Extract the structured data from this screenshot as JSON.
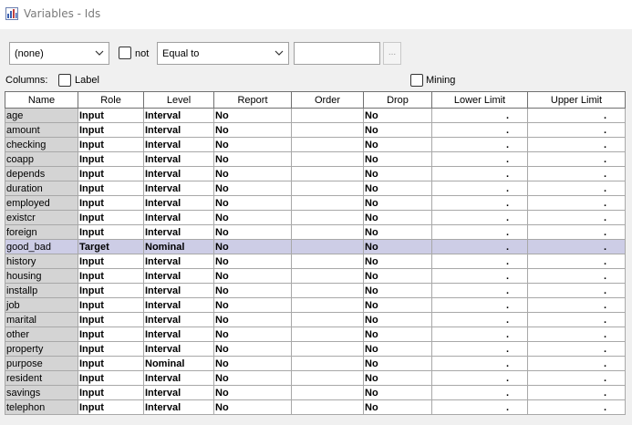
{
  "window": {
    "title": "Variables - Ids"
  },
  "filter": {
    "column_select": "(none)",
    "not_label": "not",
    "operator_select": "Equal to",
    "value_input": "",
    "ellipsis_label": "..."
  },
  "columns_row": {
    "columns_label": "Columns:",
    "label_checkbox": "Label",
    "mining_checkbox": "Mining"
  },
  "table": {
    "headers": [
      "Name",
      "Role",
      "Level",
      "Report",
      "Order",
      "Drop",
      "Lower Limit",
      "Upper Limit"
    ],
    "rows": [
      {
        "name": "age",
        "role": "Input",
        "level": "Interval",
        "report": "No",
        "order": "",
        "drop": "No",
        "lower": ".",
        "upper": "."
      },
      {
        "name": "amount",
        "role": "Input",
        "level": "Interval",
        "report": "No",
        "order": "",
        "drop": "No",
        "lower": ".",
        "upper": "."
      },
      {
        "name": "checking",
        "role": "Input",
        "level": "Interval",
        "report": "No",
        "order": "",
        "drop": "No",
        "lower": ".",
        "upper": "."
      },
      {
        "name": "coapp",
        "role": "Input",
        "level": "Interval",
        "report": "No",
        "order": "",
        "drop": "No",
        "lower": ".",
        "upper": "."
      },
      {
        "name": "depends",
        "role": "Input",
        "level": "Interval",
        "report": "No",
        "order": "",
        "drop": "No",
        "lower": ".",
        "upper": "."
      },
      {
        "name": "duration",
        "role": "Input",
        "level": "Interval",
        "report": "No",
        "order": "",
        "drop": "No",
        "lower": ".",
        "upper": "."
      },
      {
        "name": "employed",
        "role": "Input",
        "level": "Interval",
        "report": "No",
        "order": "",
        "drop": "No",
        "lower": ".",
        "upper": "."
      },
      {
        "name": "existcr",
        "role": "Input",
        "level": "Interval",
        "report": "No",
        "order": "",
        "drop": "No",
        "lower": ".",
        "upper": "."
      },
      {
        "name": "foreign",
        "role": "Input",
        "level": "Interval",
        "report": "No",
        "order": "",
        "drop": "No",
        "lower": ".",
        "upper": "."
      },
      {
        "name": "good_bad",
        "role": "Target",
        "level": "Nominal",
        "report": "No",
        "order": "",
        "drop": "No",
        "lower": ".",
        "upper": ".",
        "selected": true
      },
      {
        "name": "history",
        "role": "Input",
        "level": "Interval",
        "report": "No",
        "order": "",
        "drop": "No",
        "lower": ".",
        "upper": "."
      },
      {
        "name": "housing",
        "role": "Input",
        "level": "Interval",
        "report": "No",
        "order": "",
        "drop": "No",
        "lower": ".",
        "upper": "."
      },
      {
        "name": "installp",
        "role": "Input",
        "level": "Interval",
        "report": "No",
        "order": "",
        "drop": "No",
        "lower": ".",
        "upper": "."
      },
      {
        "name": "job",
        "role": "Input",
        "level": "Interval",
        "report": "No",
        "order": "",
        "drop": "No",
        "lower": ".",
        "upper": "."
      },
      {
        "name": "marital",
        "role": "Input",
        "level": "Interval",
        "report": "No",
        "order": "",
        "drop": "No",
        "lower": ".",
        "upper": "."
      },
      {
        "name": "other",
        "role": "Input",
        "level": "Interval",
        "report": "No",
        "order": "",
        "drop": "No",
        "lower": ".",
        "upper": "."
      },
      {
        "name": "property",
        "role": "Input",
        "level": "Interval",
        "report": "No",
        "order": "",
        "drop": "No",
        "lower": ".",
        "upper": "."
      },
      {
        "name": "purpose",
        "role": "Input",
        "level": "Nominal",
        "report": "No",
        "order": "",
        "drop": "No",
        "lower": ".",
        "upper": "."
      },
      {
        "name": "resident",
        "role": "Input",
        "level": "Interval",
        "report": "No",
        "order": "",
        "drop": "No",
        "lower": ".",
        "upper": "."
      },
      {
        "name": "savings",
        "role": "Input",
        "level": "Interval",
        "report": "No",
        "order": "",
        "drop": "No",
        "lower": ".",
        "upper": "."
      },
      {
        "name": "telephon",
        "role": "Input",
        "level": "Interval",
        "report": "No",
        "order": "",
        "drop": "No",
        "lower": ".",
        "upper": "."
      }
    ]
  },
  "colors": {
    "selected_row": "#cdcde6",
    "name_cell": "#d4d4d4"
  }
}
